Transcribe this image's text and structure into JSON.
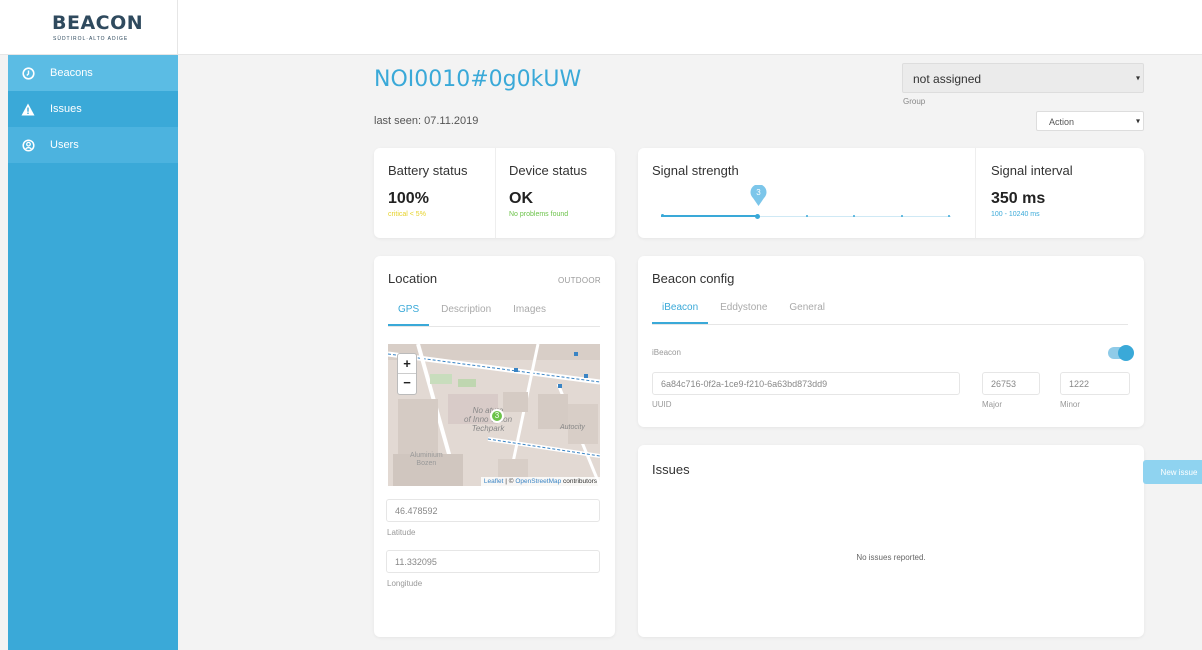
{
  "logo": {
    "main": "BEACON",
    "sub": "SÜDTIROL·ALTO ADIGE"
  },
  "sidebar": {
    "items": [
      {
        "label": "Beacons",
        "icon": "clock-icon"
      },
      {
        "label": "Issues",
        "icon": "warning-icon"
      },
      {
        "label": "Users",
        "icon": "user-circle-icon"
      }
    ]
  },
  "header": {
    "beacon_id": "NOI0010#0g0kUW",
    "last_seen": "last seen: 07.11.2019",
    "group_value": "not assigned",
    "group_label": "Group",
    "action_value": "Action"
  },
  "status": {
    "battery_title": "Battery status",
    "battery_value": "100%",
    "battery_note": "critical < 5%",
    "device_title": "Device status",
    "device_value": "OK",
    "device_note": "No problems found"
  },
  "signal": {
    "strength_title": "Signal strength",
    "strength_level": "3",
    "strength_fraction": 0.33,
    "interval_title": "Signal interval",
    "interval_value": "350 ms",
    "interval_range": "100 - 10240 ms"
  },
  "location": {
    "title": "Location",
    "type": "OUTDOOR",
    "tabs": [
      "GPS",
      "Description",
      "Images"
    ],
    "map_labels": {
      "zoom_in": "+",
      "zoom_out": "−",
      "place1": "NOI Techpark",
      "place1_line1": "No  ature",
      "place1_line2": "of Inno vation",
      "place1_line3": "Techpark",
      "place2_line1": "Aluminium",
      "place2_line2": "Bozen",
      "place3": "Autocity",
      "cluster": "3",
      "attribution_leaflet": "Leaflet",
      "attribution_sep": " | © ",
      "attribution_osm": "OpenStreetMap",
      "attribution_rest": " contributors"
    },
    "latitude": "46.478592",
    "latitude_label": "Latitude",
    "longitude": "11.332095",
    "longitude_label": "Longitude"
  },
  "config": {
    "title": "Beacon config",
    "tabs": [
      "iBeacon",
      "Eddystone",
      "General"
    ],
    "ibeacon_label": "iBeacon",
    "uuid": "6a84c716-0f2a-1ce9-f210-6a63bd873dd9",
    "uuid_label": "UUID",
    "major": "26753",
    "major_label": "Major",
    "minor": "1222",
    "minor_label": "Minor"
  },
  "issues": {
    "title": "Issues",
    "new_button": "New issue",
    "empty_text": "No issues reported."
  },
  "colors": {
    "accent": "#3aa9d8",
    "sidebar": "#3aa9d8",
    "ok": "#6cc34a",
    "warn": "#e6d22a"
  }
}
